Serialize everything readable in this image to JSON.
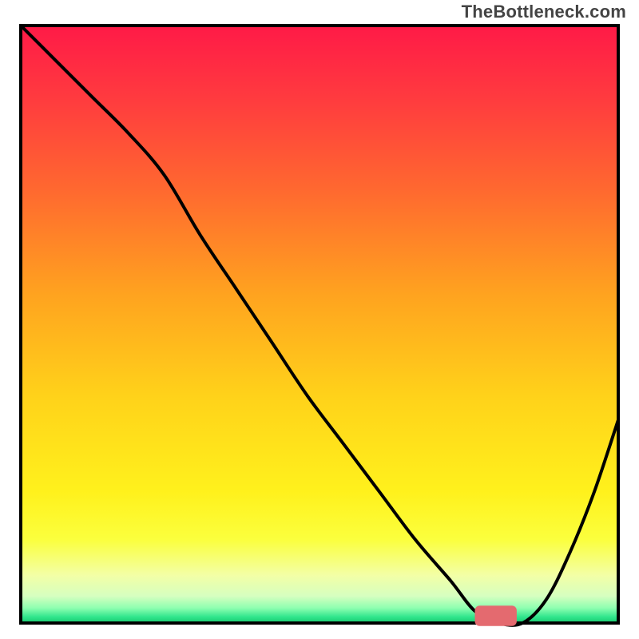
{
  "watermark": "TheBottleneck.com",
  "colors": {
    "frame": "#000000",
    "curve": "#000000",
    "marker": "#e46a6f"
  },
  "gradient_stops": [
    {
      "offset": 0.0,
      "color": "#ff1a47"
    },
    {
      "offset": 0.12,
      "color": "#ff3a3f"
    },
    {
      "offset": 0.28,
      "color": "#ff6a2f"
    },
    {
      "offset": 0.45,
      "color": "#ffa31f"
    },
    {
      "offset": 0.62,
      "color": "#ffd21a"
    },
    {
      "offset": 0.78,
      "color": "#fff11c"
    },
    {
      "offset": 0.86,
      "color": "#fbff3d"
    },
    {
      "offset": 0.92,
      "color": "#f3ffa6"
    },
    {
      "offset": 0.955,
      "color": "#d6ffc0"
    },
    {
      "offset": 0.975,
      "color": "#8dffb0"
    },
    {
      "offset": 0.99,
      "color": "#30e58c"
    },
    {
      "offset": 1.0,
      "color": "#17c86f"
    }
  ],
  "chart_data": {
    "type": "line",
    "title": "",
    "xlabel": "",
    "ylabel": "",
    "xlim": [
      0,
      100
    ],
    "ylim": [
      0,
      100
    ],
    "x": [
      0,
      6,
      12,
      18,
      24,
      30,
      36,
      42,
      48,
      54,
      60,
      66,
      72,
      76,
      80,
      84,
      88,
      92,
      96,
      100
    ],
    "y": [
      100,
      94,
      88,
      82,
      75,
      65,
      56,
      47,
      38,
      30,
      22,
      14,
      7,
      2,
      0,
      0,
      4,
      12,
      22,
      34
    ],
    "marker": {
      "x_start": 76,
      "x_end": 83,
      "y": 1.2,
      "height": 3.4
    }
  }
}
